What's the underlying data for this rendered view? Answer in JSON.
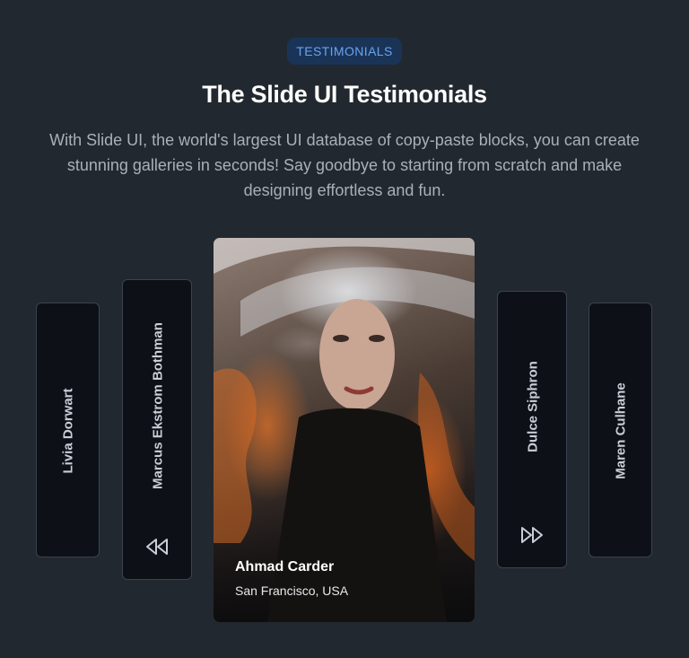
{
  "badge": "TESTIMONIALS",
  "title": "The Slide UI Testimonials",
  "description": "With Slide UI, the world's largest UI database of copy-paste blocks, you can create stunning galleries in seconds! Say goodbye to starting from scratch and make designing effortless and fun.",
  "cards": [
    {
      "name": "Livia Dorwart"
    },
    {
      "name": "Marcus Ekstrom Bothman"
    },
    {
      "name": "Dulce Siphron"
    },
    {
      "name": "Maren Culhane"
    }
  ],
  "featured": {
    "name": "Ahmad Carder",
    "location": "San Francisco, USA"
  },
  "icons": {
    "prev": "rewind-icon",
    "next": "fast-forward-icon"
  }
}
